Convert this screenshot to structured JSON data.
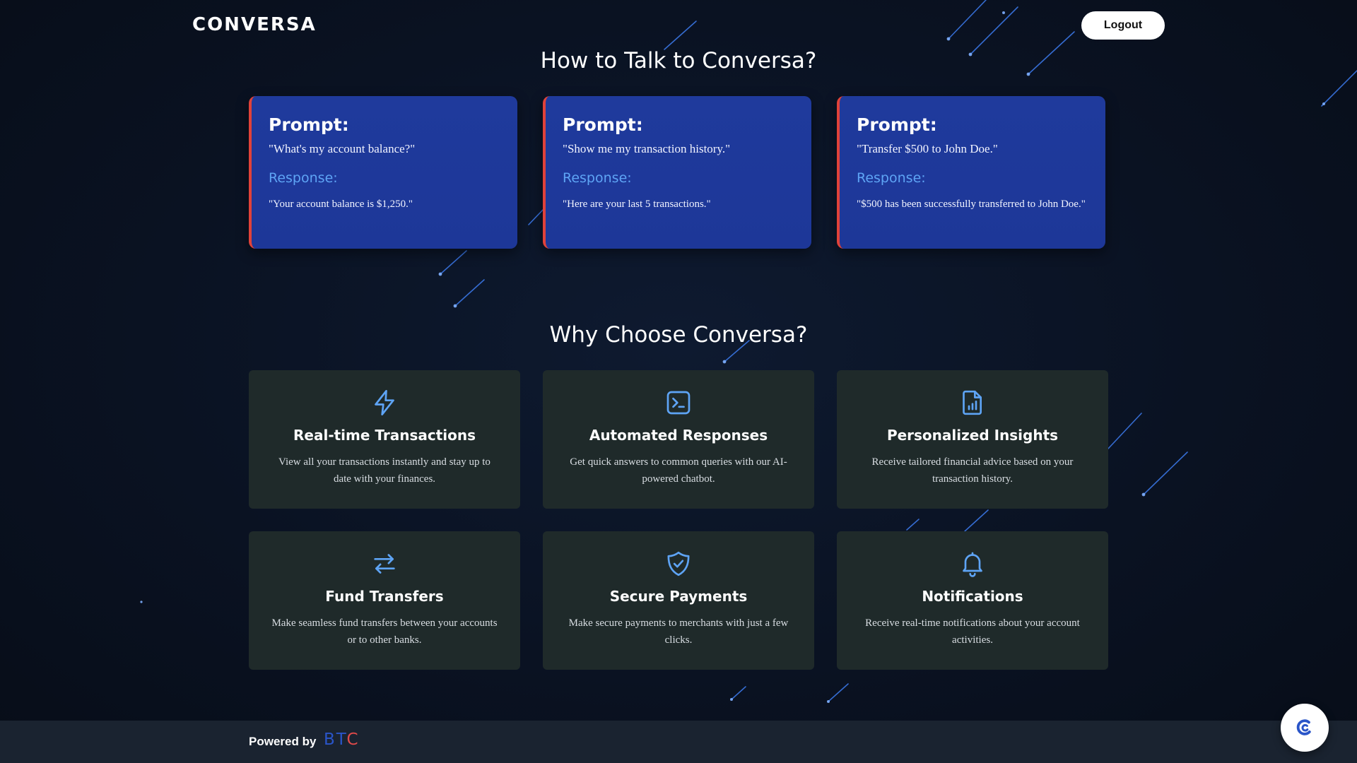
{
  "header": {
    "brand": "CONVERSA",
    "logout_label": "Logout"
  },
  "talk_section": {
    "title": "How to Talk to Conversa?",
    "cards": [
      {
        "prompt_label": "Prompt:",
        "prompt": "\"What's my account balance?\"",
        "response_label": "Response:",
        "response": "\"Your account balance is $1,250.\""
      },
      {
        "prompt_label": "Prompt:",
        "prompt": "\"Show me my transaction history.\"",
        "response_label": "Response:",
        "response": "\"Here are your last 5 transactions.\""
      },
      {
        "prompt_label": "Prompt:",
        "prompt": "\"Transfer $500 to John Doe.\"",
        "response_label": "Response:",
        "response": "\"$500 has been successfully transferred to John Doe.\""
      }
    ]
  },
  "why_section": {
    "title": "Why Choose Conversa?",
    "features": [
      {
        "icon": "lightning-icon",
        "title": "Real-time Transactions",
        "description": "View all your transactions instantly and stay up to date with your finances."
      },
      {
        "icon": "terminal-icon",
        "title": "Automated Responses",
        "description": "Get quick answers to common queries with our AI-powered chatbot."
      },
      {
        "icon": "document-chart-icon",
        "title": "Personalized Insights",
        "description": "Receive tailored financial advice based on your transaction history."
      },
      {
        "icon": "arrows-swap-icon",
        "title": "Fund Transfers",
        "description": "Make seamless fund transfers between your accounts or to other banks."
      },
      {
        "icon": "shield-check-icon",
        "title": "Secure Payments",
        "description": "Make secure payments to merchants with just a few clicks."
      },
      {
        "icon": "bell-icon",
        "title": "Notifications",
        "description": "Receive real-time notifications about your account activities."
      }
    ]
  },
  "footer": {
    "powered_label": "Powered by",
    "logo_text_a": "BT",
    "logo_text_b": "C"
  },
  "colors": {
    "accent_blue": "#5ea4f5",
    "card_blue": "#1f3a9c",
    "card_border_red": "#e0423a",
    "feature_bg": "#1f2a2a"
  }
}
